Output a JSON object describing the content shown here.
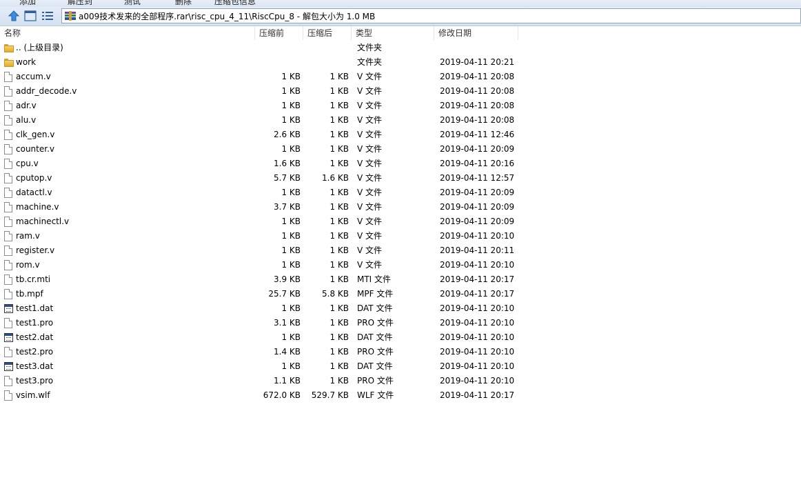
{
  "toolbar": {
    "items": [
      "添加",
      "解压到",
      "测试",
      "删除",
      "压缩包信息"
    ]
  },
  "address": {
    "path": "a009技术发来的全部程序.rar\\risc_cpu_4_11\\RiscCpu_8 - 解包大小为 1.0 MB"
  },
  "columns": {
    "name": "名称",
    "compressed": "压缩前",
    "size": "压缩后",
    "type": "类型",
    "date": "修改日期"
  },
  "files": [
    {
      "name": ".. (上级目录)",
      "compressed": "",
      "size": "",
      "type": "文件夹",
      "date": "",
      "icon": "folder-icon"
    },
    {
      "name": "work",
      "compressed": "",
      "size": "",
      "type": "文件夹",
      "date": "2019-04-11 20:21",
      "icon": "folder-icon"
    },
    {
      "name": "accum.v",
      "compressed": "1 KB",
      "size": "1 KB",
      "type": "V 文件",
      "date": "2019-04-11 20:08",
      "icon": "file-icon"
    },
    {
      "name": "addr_decode.v",
      "compressed": "1 KB",
      "size": "1 KB",
      "type": "V 文件",
      "date": "2019-04-11 20:08",
      "icon": "file-icon"
    },
    {
      "name": "adr.v",
      "compressed": "1 KB",
      "size": "1 KB",
      "type": "V 文件",
      "date": "2019-04-11 20:08",
      "icon": "file-icon"
    },
    {
      "name": "alu.v",
      "compressed": "1 KB",
      "size": "1 KB",
      "type": "V 文件",
      "date": "2019-04-11 20:08",
      "icon": "file-icon"
    },
    {
      "name": "clk_gen.v",
      "compressed": "2.6 KB",
      "size": "1 KB",
      "type": "V 文件",
      "date": "2019-04-11 12:46",
      "icon": "file-icon"
    },
    {
      "name": "counter.v",
      "compressed": "1 KB",
      "size": "1 KB",
      "type": "V 文件",
      "date": "2019-04-11 20:09",
      "icon": "file-icon"
    },
    {
      "name": "cpu.v",
      "compressed": "1.6 KB",
      "size": "1 KB",
      "type": "V 文件",
      "date": "2019-04-11 20:16",
      "icon": "file-icon"
    },
    {
      "name": "cputop.v",
      "compressed": "5.7 KB",
      "size": "1.6 KB",
      "type": "V 文件",
      "date": "2019-04-11 12:57",
      "icon": "file-icon"
    },
    {
      "name": "datactl.v",
      "compressed": "1 KB",
      "size": "1 KB",
      "type": "V 文件",
      "date": "2019-04-11 20:09",
      "icon": "file-icon"
    },
    {
      "name": "machine.v",
      "compressed": "3.7 KB",
      "size": "1 KB",
      "type": "V 文件",
      "date": "2019-04-11 20:09",
      "icon": "file-icon"
    },
    {
      "name": "machinectl.v",
      "compressed": "1 KB",
      "size": "1 KB",
      "type": "V 文件",
      "date": "2019-04-11 20:09",
      "icon": "file-icon"
    },
    {
      "name": "ram.v",
      "compressed": "1 KB",
      "size": "1 KB",
      "type": "V 文件",
      "date": "2019-04-11 20:10",
      "icon": "file-icon"
    },
    {
      "name": "register.v",
      "compressed": "1 KB",
      "size": "1 KB",
      "type": "V 文件",
      "date": "2019-04-11 20:11",
      "icon": "file-icon"
    },
    {
      "name": "rom.v",
      "compressed": "1 KB",
      "size": "1 KB",
      "type": "V 文件",
      "date": "2019-04-11 20:10",
      "icon": "file-icon"
    },
    {
      "name": "tb.cr.mti",
      "compressed": "3.9 KB",
      "size": "1 KB",
      "type": "MTI 文件",
      "date": "2019-04-11 20:17",
      "icon": "file-icon"
    },
    {
      "name": "tb.mpf",
      "compressed": "25.7 KB",
      "size": "5.8 KB",
      "type": "MPF 文件",
      "date": "2019-04-11 20:17",
      "icon": "file-icon"
    },
    {
      "name": "test1.dat",
      "compressed": "1 KB",
      "size": "1 KB",
      "type": "DAT 文件",
      "date": "2019-04-11 20:10",
      "icon": "dat-file-icon"
    },
    {
      "name": "test1.pro",
      "compressed": "3.1 KB",
      "size": "1 KB",
      "type": "PRO 文件",
      "date": "2019-04-11 20:10",
      "icon": "file-icon"
    },
    {
      "name": "test2.dat",
      "compressed": "1 KB",
      "size": "1 KB",
      "type": "DAT 文件",
      "date": "2019-04-11 20:10",
      "icon": "dat-file-icon"
    },
    {
      "name": "test2.pro",
      "compressed": "1.4 KB",
      "size": "1 KB",
      "type": "PRO 文件",
      "date": "2019-04-11 20:10",
      "icon": "file-icon"
    },
    {
      "name": "test3.dat",
      "compressed": "1 KB",
      "size": "1 KB",
      "type": "DAT 文件",
      "date": "2019-04-11 20:10",
      "icon": "dat-file-icon"
    },
    {
      "name": "test3.pro",
      "compressed": "1.1 KB",
      "size": "1 KB",
      "type": "PRO 文件",
      "date": "2019-04-11 20:10",
      "icon": "file-icon"
    },
    {
      "name": "vsim.wlf",
      "compressed": "672.0 KB",
      "size": "529.7 KB",
      "type": "WLF 文件",
      "date": "2019-04-11 20:17",
      "icon": "file-icon"
    }
  ]
}
